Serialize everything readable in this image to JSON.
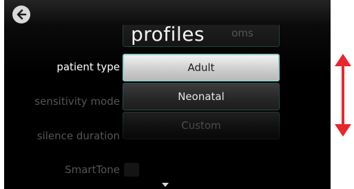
{
  "screen": {
    "title": "profiles",
    "back_icon": "arrow-left-icon"
  },
  "settings": [
    {
      "label": "patient type",
      "active": true
    },
    {
      "label": "sensitivity mode",
      "active": false
    },
    {
      "label": "silence duration",
      "active": false
    },
    {
      "label": "SmartTone",
      "active": false
    }
  ],
  "picker": {
    "options": [
      "Adult",
      "Neonatal",
      "Custom"
    ],
    "partial_top_text": "oms",
    "selected": "Adult"
  },
  "colors": {
    "accent": "#8fcfc8",
    "arrow": "#e8262b"
  },
  "icons": {
    "scroll_down": "caret-down-icon",
    "scroll_indicator": "double-arrow-vertical-icon"
  }
}
